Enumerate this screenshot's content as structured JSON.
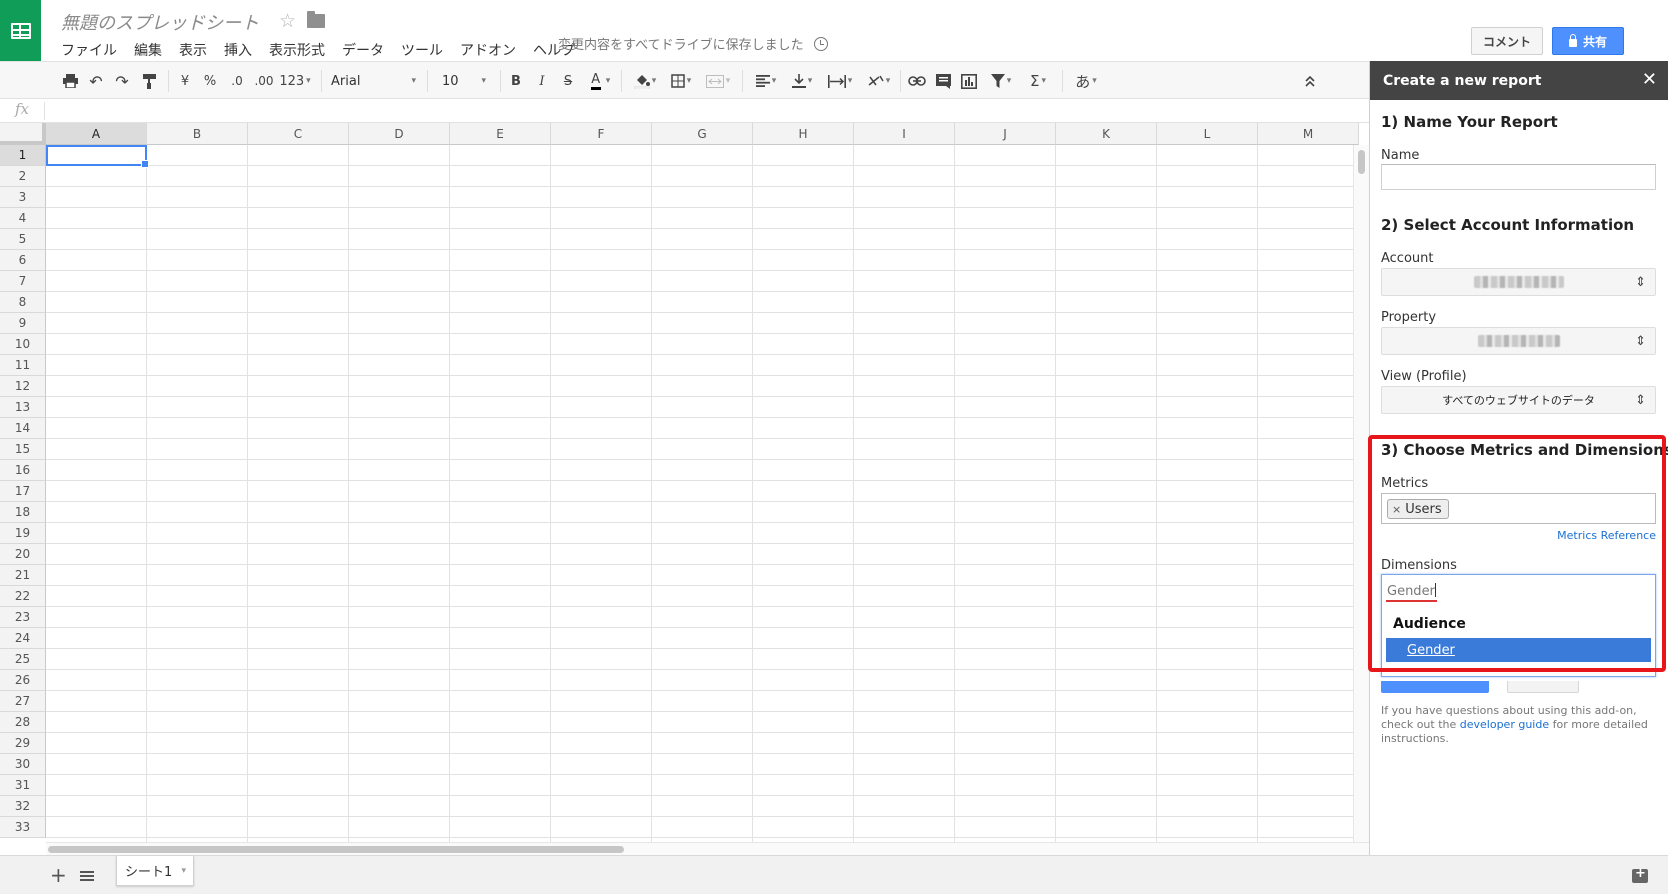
{
  "app": {
    "doc_title": "無題のスプレッドシート",
    "menus": [
      "ファイル",
      "編集",
      "表示",
      "挿入",
      "表示形式",
      "データ",
      "ツール",
      "アドオン",
      "ヘルプ"
    ],
    "save_status": "変更内容をすべてドライブに保存しました",
    "comment_label": "コメント",
    "share_label": "共有",
    "brand_color": "#0f9d58",
    "accent_color": "#4d90fe"
  },
  "toolbar": {
    "currency": "¥",
    "percent": "%",
    "decrease_decimals": ".0",
    "increase_decimals": ".00",
    "more_formats": "123",
    "font_family": "Arial",
    "font_size": "10",
    "bold": "B",
    "italic": "I",
    "strikethrough": "S",
    "text_color": "A",
    "sum": "Σ",
    "input_tools": "あ",
    "icons": [
      "print-icon",
      "undo-icon",
      "redo-icon",
      "paint-format-icon",
      "fill-color-icon",
      "borders-icon",
      "merge-cells-icon",
      "align-left-icon",
      "vertical-align-icon",
      "text-wrap-icon",
      "text-rotate-icon",
      "link-icon",
      "comment-icon",
      "chart-icon",
      "filter-icon",
      "collapse-icon"
    ]
  },
  "formula_bar": {
    "label": "fx"
  },
  "grid": {
    "columns": [
      "A",
      "B",
      "C",
      "D",
      "E",
      "F",
      "G",
      "H",
      "I",
      "J",
      "K",
      "L",
      "M"
    ],
    "rows": [
      "1",
      "2",
      "3",
      "4",
      "5",
      "6",
      "7",
      "8",
      "9",
      "10",
      "11",
      "12",
      "13",
      "14",
      "15",
      "16",
      "17",
      "18",
      "19",
      "20",
      "21",
      "22",
      "23",
      "24",
      "25",
      "26",
      "27",
      "28",
      "29",
      "30",
      "31",
      "32",
      "33"
    ],
    "active_cell": "A1"
  },
  "sheets": {
    "tabs": [
      "シート1"
    ],
    "add_label": "+"
  },
  "panel": {
    "title": "Create a new report",
    "close": "✕",
    "section1_title": "1) Name Your Report",
    "name_label": "Name",
    "name_value": "",
    "section2_title": "2) Select Account Information",
    "account_label": "Account",
    "property_label": "Property",
    "view_label": "View (Profile)",
    "view_value": "すべてのウェブサイトのデータ",
    "section3_title": "3) Choose Metrics and Dimensions",
    "metrics_label": "Metrics",
    "metric_chip_remove": "×",
    "metric_chip": "Users",
    "metrics_reference": "Metrics Reference",
    "dimensions_label": "Dimensions",
    "dimensions_input": "Gender",
    "dropdown_group": "Audience",
    "dropdown_option": "Gender",
    "help_text_before": "If you have questions about using this add-on, check out the ",
    "help_link": "developer guide",
    "help_text_after": " for more detailed instructions.",
    "highlight_color": "#e8161b"
  }
}
